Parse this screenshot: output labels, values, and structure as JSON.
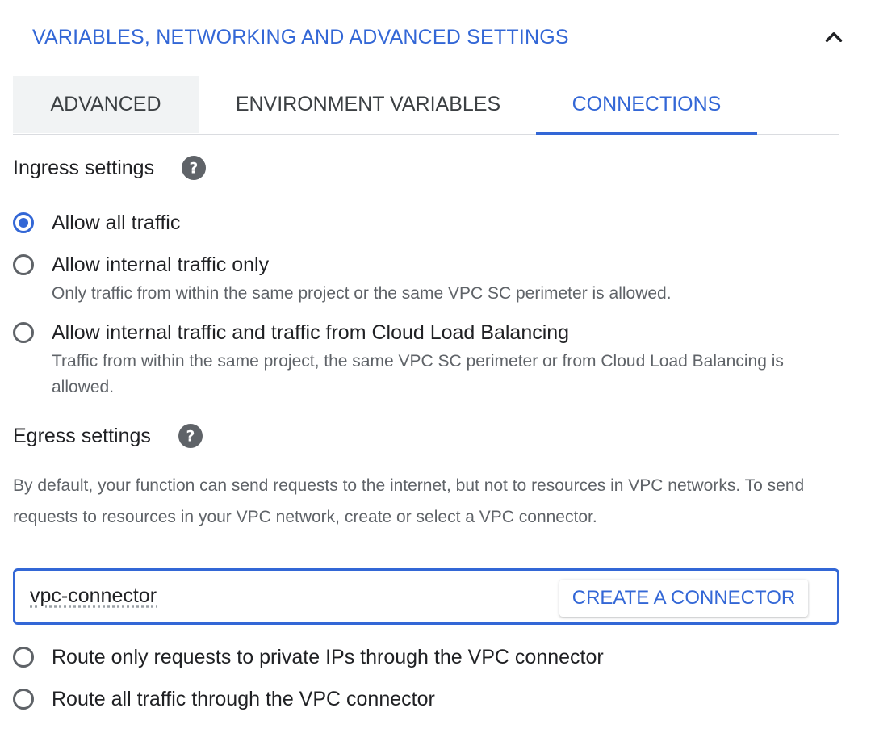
{
  "section": {
    "title": "VARIABLES, NETWORKING AND ADVANCED SETTINGS",
    "collapse_icon": "chevron-up-icon"
  },
  "tabs": [
    {
      "label": "ADVANCED",
      "selected": false
    },
    {
      "label": "ENVIRONMENT VARIABLES",
      "selected": false
    },
    {
      "label": "CONNECTIONS",
      "selected": true
    }
  ],
  "ingress": {
    "heading": "Ingress settings",
    "help_icon": "help-icon",
    "options": [
      {
        "label": "Allow all traffic",
        "description": "",
        "selected": true
      },
      {
        "label": "Allow internal traffic only",
        "description": "Only traffic from within the same project or the same VPC SC perimeter is allowed.",
        "selected": false
      },
      {
        "label": "Allow internal traffic and traffic from Cloud Load Balancing",
        "description": "Traffic from within the same project, the same VPC SC perimeter or from Cloud Load Balancing is allowed.",
        "selected": false
      }
    ]
  },
  "egress": {
    "heading": "Egress settings",
    "help_icon": "help-icon",
    "description": "By default, your function can send requests to the internet, but not to resources in VPC networks. To send requests to resources in your VPC network, create or select a VPC connector.",
    "connector_value": "vpc-connector",
    "create_button": "CREATE A CONNECTOR",
    "options": [
      {
        "label": "Route only requests to private IPs through the VPC connector",
        "selected": false
      },
      {
        "label": "Route all traffic through the VPC connector",
        "selected": false
      }
    ]
  },
  "colors": {
    "accent": "#3367d6",
    "text": "#202124",
    "secondary_text": "#5f6368",
    "tab_background": "#f1f3f4"
  }
}
